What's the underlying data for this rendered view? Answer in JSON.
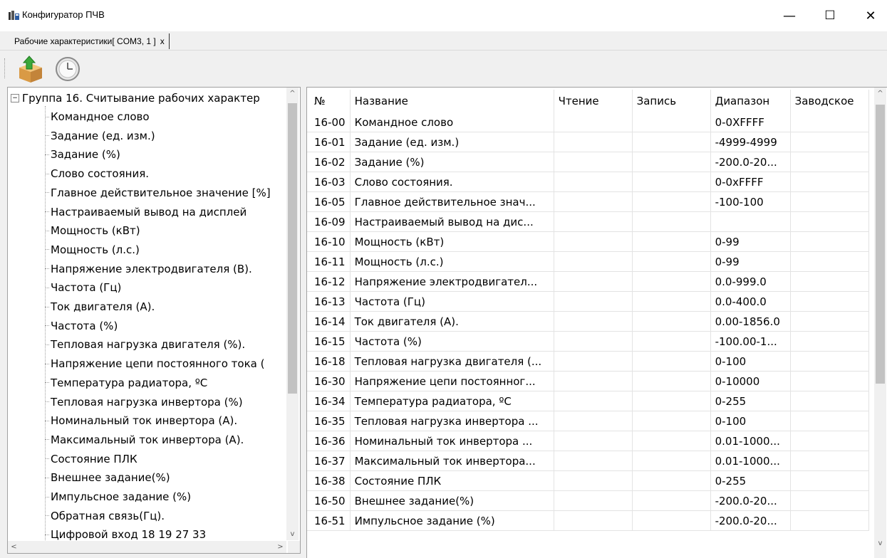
{
  "window": {
    "title": "Конфигуратор ПЧВ",
    "minimize": "—",
    "maximize": "☐",
    "close": "✕"
  },
  "tab": {
    "label": "Рабочие характеристики[ COM3, 1 ]",
    "close": "x"
  },
  "toolbar": {
    "upload_icon": "upload-box-icon",
    "clock_icon": "clock-icon"
  },
  "tree": {
    "group_label": "Группа 16. Считывание рабочих характер",
    "expander": "−",
    "items": [
      "Командное слово",
      "Задание (ед. изм.)",
      "Задание (%)",
      "Слово состояния.",
      "Главное действительное значение [%]",
      "Настраиваемый вывод на дисплей",
      "Мощность (кВт)",
      "Мощность (л.с.)",
      "Напряжение электродвигателя (В).",
      "Частота (Гц)",
      "Ток двигателя (А).",
      "Частота (%)",
      "Тепловая нагрузка двигателя (%).",
      "Напряжение цепи постоянного тока (",
      "Температура радиатора, ºС",
      "Тепловая нагрузка инвертора (%)",
      "Номинальный ток инвертора (А).",
      "Максимальный ток инвертора (А).",
      "Состояние ПЛК",
      "Внешнее задание(%)",
      "Импульсное задание (%)",
      "Обратная связь(Гц).",
      "Цифровой вход 18 19 27 33"
    ]
  },
  "grid": {
    "columns": [
      "№",
      "Название",
      "Чтение",
      "Запись",
      "Диапазон",
      "Заводское"
    ],
    "rows": [
      [
        "16-00",
        "Командное слово",
        "",
        "",
        "0-0XFFFF",
        ""
      ],
      [
        "16-01",
        "Задание (ед. изм.)",
        "",
        "",
        "-4999-4999",
        ""
      ],
      [
        "16-02",
        "Задание (%)",
        "",
        "",
        "-200.0-20...",
        ""
      ],
      [
        "16-03",
        "Слово состояния.",
        "",
        "",
        "0-0xFFFF",
        ""
      ],
      [
        "16-05",
        "Главное действительное знач...",
        "",
        "",
        "-100-100",
        ""
      ],
      [
        "16-09",
        "Настраиваемый вывод на дис...",
        "",
        "",
        "",
        ""
      ],
      [
        "16-10",
        "Мощность (кВт)",
        "",
        "",
        "0-99",
        ""
      ],
      [
        "16-11",
        "Мощность (л.с.)",
        "",
        "",
        "0-99",
        ""
      ],
      [
        "16-12",
        "Напряжение электродвигател...",
        "",
        "",
        "0.0-999.0",
        ""
      ],
      [
        "16-13",
        "Частота (Гц)",
        "",
        "",
        "0.0-400.0",
        ""
      ],
      [
        "16-14",
        "Ток двигателя (А).",
        "",
        "",
        "0.00-1856.0",
        ""
      ],
      [
        "16-15",
        "Частота (%)",
        "",
        "",
        "-100.00-1...",
        ""
      ],
      [
        "16-18",
        "Тепловая нагрузка двигателя (...",
        "",
        "",
        "0-100",
        ""
      ],
      [
        "16-30",
        "Напряжение цепи постоянног...",
        "",
        "",
        "0-10000",
        ""
      ],
      [
        "16-34",
        "Температура радиатора, ºС",
        "",
        "",
        "0-255",
        ""
      ],
      [
        "16-35",
        "Тепловая нагрузка инвертора ...",
        "",
        "",
        "0-100",
        ""
      ],
      [
        "16-36",
        "Номинальный ток инвертора ...",
        "",
        "",
        "0.01-1000...",
        ""
      ],
      [
        "16-37",
        "Максимальный ток инвертора...",
        "",
        "",
        "0.01-1000...",
        ""
      ],
      [
        "16-38",
        "Состояние ПЛК",
        "",
        "",
        "0-255",
        ""
      ],
      [
        "16-50",
        "Внешнее задание(%)",
        "",
        "",
        "-200.0-20...",
        ""
      ],
      [
        "16-51",
        "Импульсное задание (%)",
        "",
        "",
        "-200.0-20...",
        ""
      ]
    ]
  },
  "scroll": {
    "up": "^",
    "down": "v",
    "left": "<",
    "right": ">"
  }
}
